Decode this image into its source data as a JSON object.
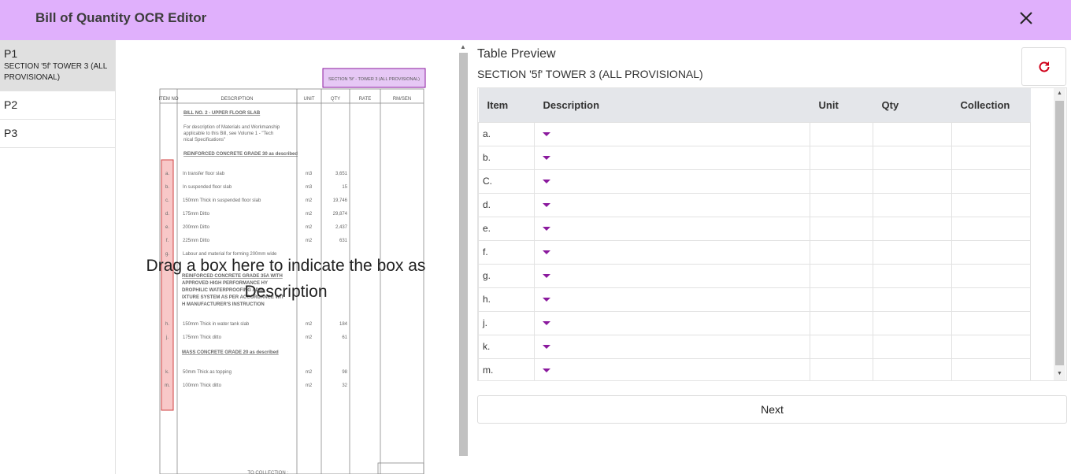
{
  "header": {
    "title": "Bill of Quantity OCR Editor"
  },
  "pages": [
    {
      "name": "P1",
      "subtitle": "SECTION '5f' TOWER 3 (ALL PROVISIONAL)"
    },
    {
      "name": "P2",
      "subtitle": ""
    },
    {
      "name": "P3",
      "subtitle": ""
    }
  ],
  "document": {
    "section_box": "SECTION '5f' - TOWER 3 (ALL PROVISIONAL)",
    "headers": [
      "ITEM NO",
      "DESCRIPTION",
      "UNIT",
      "QTY",
      "RATE",
      "RM/SEN"
    ],
    "heading": "BILL NO. 2 - UPPER FLOOR SLAB",
    "intro": "For description of Materials and Workmanship applicable to this Bill, see Volume 1 - \"Technical Specifications\"",
    "subheading_1": "REINFORCED CONCRETE GRADE 30 as described",
    "subheading_2": "REINFORCED CONCRETE GRADE 35A WITH APPROVED HIGH PERFORMANCE HYDROPHILIC WATERPROOFING ADMIXTURE SYSTEM AS PER ACCORDANCE WITH MANUFACTURER'S INSTRUCTION",
    "subheading_3": "MASS CONCRETE GRADE 20 as described",
    "footer": "TO COLLECTION :",
    "rows": [
      {
        "item": "a.",
        "desc": "In transfer floor slab",
        "unit": "m3",
        "qty": "3,651"
      },
      {
        "item": "b.",
        "desc": "In suspended floor slab",
        "unit": "m3",
        "qty": "15"
      },
      {
        "item": "c.",
        "desc": "150mm Thick in suspended floor slab",
        "unit": "m2",
        "qty": "19,746"
      },
      {
        "item": "d.",
        "desc": "175mm Ditto",
        "unit": "m2",
        "qty": "29,874"
      },
      {
        "item": "e.",
        "desc": "200mm Ditto",
        "unit": "m2",
        "qty": "2,437"
      },
      {
        "item": "f.",
        "desc": "225mm Ditto",
        "unit": "m2",
        "qty": "631"
      },
      {
        "item": "g.",
        "desc": "Labour and material for forming 200mm wide",
        "unit": "",
        "qty": ""
      },
      {
        "item": "h.",
        "desc": "150mm Thick in water tank slab",
        "unit": "m2",
        "qty": "184"
      },
      {
        "item": "j.",
        "desc": "175mm Thick ditto",
        "unit": "m2",
        "qty": "61"
      },
      {
        "item": "k.",
        "desc": "50mm Thick as topping",
        "unit": "m2",
        "qty": "98"
      },
      {
        "item": "m.",
        "desc": "100mm Thick ditto",
        "unit": "m2",
        "qty": "32"
      }
    ],
    "drag_hint": "Drag a box here to indicate the box as Description"
  },
  "preview": {
    "title": "Table Preview",
    "section": "SECTION '5f' TOWER 3 (ALL PROVISIONAL)",
    "columns": [
      "Item",
      "Description",
      "Unit",
      "Qty",
      "Collection"
    ],
    "rows": [
      "a.",
      "b.",
      "C.",
      "d.",
      "e.",
      "f.",
      "g.",
      "h.",
      "j.",
      "k.",
      "m."
    ]
  },
  "actions": {
    "next_label": "Next"
  },
  "colors": {
    "header_bg": "#e0b0fc",
    "accent": "#8b1a9e",
    "refresh": "#d0021b"
  },
  "icons": {
    "close": "close-icon",
    "refresh": "refresh-icon",
    "dropdown": "caret-down-icon"
  }
}
